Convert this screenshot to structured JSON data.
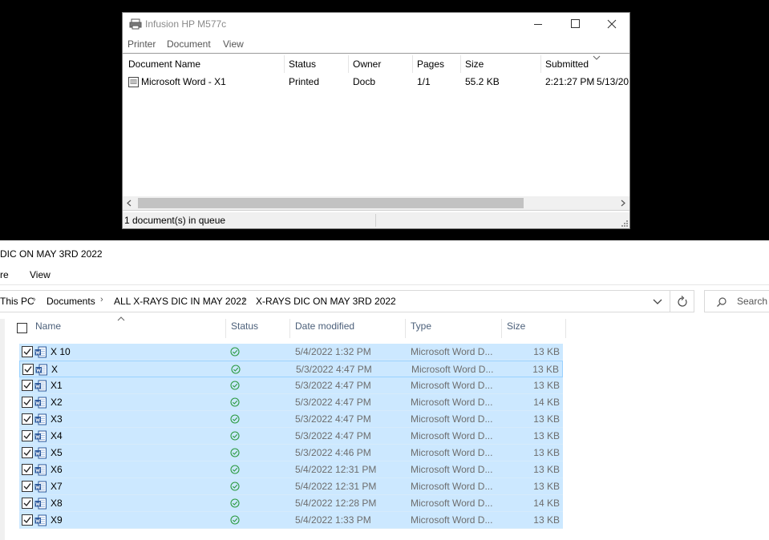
{
  "print_queue": {
    "title": "Infusion HP M577c",
    "menu": [
      "Printer",
      "Document",
      "View"
    ],
    "columns": [
      "Document Name",
      "Status",
      "Owner",
      "Pages",
      "Size",
      "Submitted"
    ],
    "jobs": [
      {
        "name": "Microsoft Word - X1",
        "status": "Printed",
        "owner": "Docb",
        "pages": "1/1",
        "size": "55.2 KB",
        "time": "2:21:27 PM",
        "date": "5/13/20"
      }
    ],
    "status_bar": "1 document(s) in queue"
  },
  "explorer": {
    "title_fragment": "DIC ON MAY 3RD 2022",
    "ribbon": {
      "tab_share_fragment": "re",
      "tab_view": "View"
    },
    "breadcrumbs": [
      "This PC",
      "Documents",
      "ALL X-RAYS DIC IN MAY 2022",
      "X-RAYS DIC ON MAY 3RD 2022"
    ],
    "search_placeholder": "Search X",
    "columns": {
      "name": "Name",
      "status": "Status",
      "date": "Date modified",
      "type": "Type",
      "size": "Size"
    },
    "files": [
      {
        "name": "X 10",
        "date": "5/4/2022 1:32 PM",
        "type": "Microsoft Word D...",
        "size": "13 KB"
      },
      {
        "name": "X",
        "date": "5/3/2022 4:47 PM",
        "type": "Microsoft Word D...",
        "size": "13 KB"
      },
      {
        "name": "X1",
        "date": "5/3/2022 4:47 PM",
        "type": "Microsoft Word D...",
        "size": "13 KB"
      },
      {
        "name": "X2",
        "date": "5/3/2022 4:47 PM",
        "type": "Microsoft Word D...",
        "size": "14 KB"
      },
      {
        "name": "X3",
        "date": "5/3/2022 4:47 PM",
        "type": "Microsoft Word D...",
        "size": "13 KB"
      },
      {
        "name": "X4",
        "date": "5/3/2022 4:47 PM",
        "type": "Microsoft Word D...",
        "size": "13 KB"
      },
      {
        "name": "X5",
        "date": "5/3/2022 4:46 PM",
        "type": "Microsoft Word D...",
        "size": "13 KB"
      },
      {
        "name": "X6",
        "date": "5/4/2022 12:31 PM",
        "type": "Microsoft Word D...",
        "size": "13 KB"
      },
      {
        "name": "X7",
        "date": "5/4/2022 12:31 PM",
        "type": "Microsoft Word D...",
        "size": "13 KB"
      },
      {
        "name": "X8",
        "date": "5/4/2022 12:28 PM",
        "type": "Microsoft Word D...",
        "size": "14 KB"
      },
      {
        "name": "X9",
        "date": "5/4/2022 1:33 PM",
        "type": "Microsoft Word D...",
        "size": "13 KB"
      }
    ]
  },
  "colors": {
    "selection": "#cce8ff",
    "sync_ok": "#2b9a3f",
    "word_blue": "#2b579a"
  }
}
